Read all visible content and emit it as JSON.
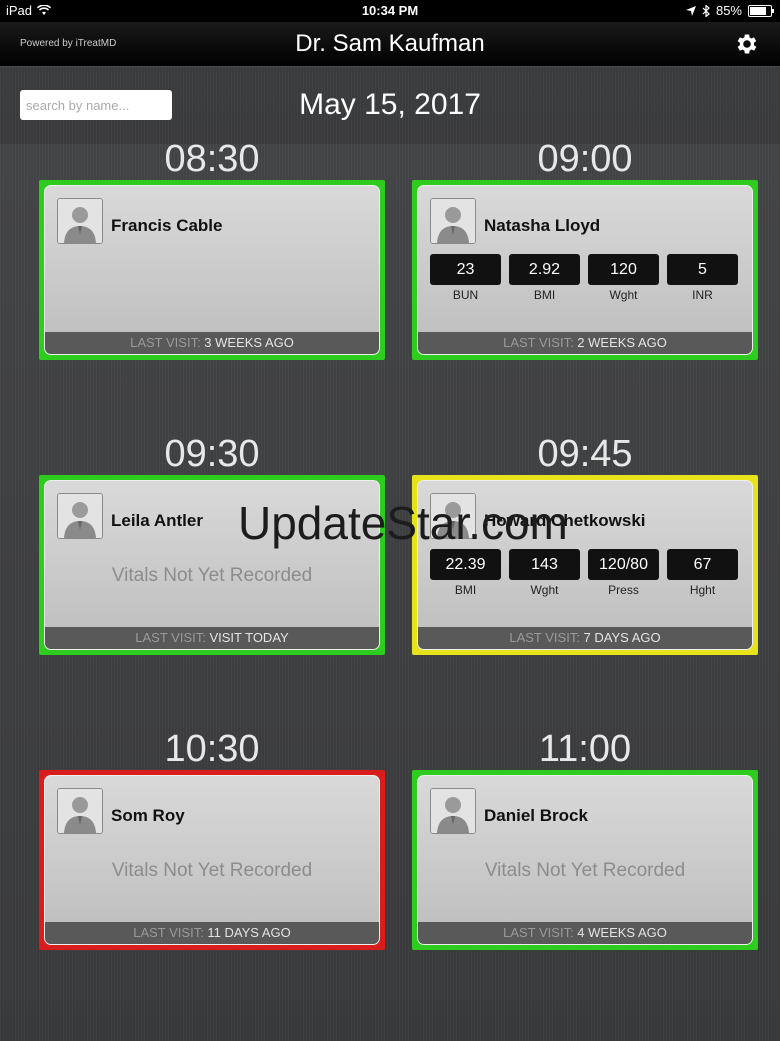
{
  "status_bar": {
    "device": "iPad",
    "time": "10:34 PM",
    "battery": "85%",
    "battery_level": 0.85
  },
  "header": {
    "powered_by": "Powered by iTreatMD",
    "doctor_name": "Dr. Sam Kaufman",
    "settings_icon": "gear-icon"
  },
  "search": {
    "placeholder": "search by name..."
  },
  "date": "May 15, 2017",
  "last_visit_label": "LAST VISIT:",
  "appointments": [
    {
      "time": "08:30",
      "patient": "Francis Cable",
      "status_color": "green",
      "vitals": [],
      "vitals_message": "",
      "last_visit": "3 WEEKS AGO"
    },
    {
      "time": "09:00",
      "patient": "Natasha Lloyd",
      "status_color": "green",
      "vitals": [
        {
          "value": "23",
          "label": "BUN"
        },
        {
          "value": "2.92",
          "label": "BMI"
        },
        {
          "value": "120",
          "label": "Wght"
        },
        {
          "value": "5",
          "label": "INR"
        }
      ],
      "vitals_message": "",
      "last_visit": "2 WEEKS AGO"
    },
    {
      "time": "09:30",
      "patient": "Leila Antler",
      "status_color": "green",
      "vitals": [],
      "vitals_message": "Vitals Not Yet Recorded",
      "last_visit": "VISIT TODAY"
    },
    {
      "time": "09:45",
      "patient": "Howard Chetkowski",
      "status_color": "yellow",
      "vitals": [
        {
          "value": "22.39",
          "label": "BMI"
        },
        {
          "value": "143",
          "label": "Wght"
        },
        {
          "value": "120/80",
          "label": "Press"
        },
        {
          "value": "67",
          "label": "Hght"
        }
      ],
      "vitals_message": "",
      "last_visit": "7 DAYS AGO"
    },
    {
      "time": "10:30",
      "patient": "Som Roy",
      "status_color": "red",
      "vitals": [],
      "vitals_message": "Vitals Not Yet Recorded",
      "last_visit": "11 DAYS AGO"
    },
    {
      "time": "11:00",
      "patient": "Daniel Brock",
      "status_color": "green",
      "vitals": [],
      "vitals_message": "Vitals Not Yet Recorded",
      "last_visit": "4 WEEKS AGO"
    }
  ],
  "watermark": "UpdateStar.com"
}
